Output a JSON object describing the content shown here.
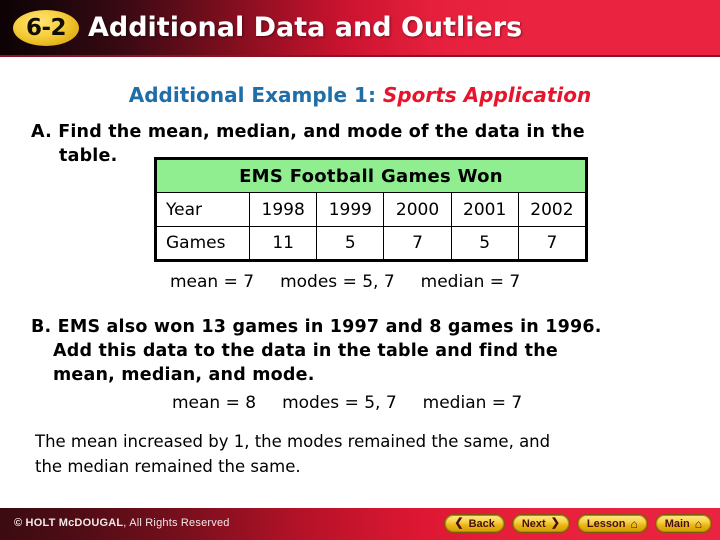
{
  "header": {
    "badge": "6-2",
    "title": "Additional Data and Outliers",
    "accent_red": "#ea2340",
    "badge_gold": "#f6cf3d"
  },
  "example_heading": {
    "lead": "Additional Example 1:",
    "emphasis": "Sports Application",
    "lead_color": "#1f6ea8",
    "emphasis_color": "#e8142b"
  },
  "part_a": {
    "line1": "A. Find the mean, median, and mode of the data in the",
    "line2": "table."
  },
  "table": {
    "caption": "EMS Football Games Won",
    "caption_bg": "#90ee90",
    "row_labels": [
      "Year",
      "Games"
    ],
    "years": [
      "1998",
      "1999",
      "2000",
      "2001",
      "2002"
    ],
    "games": [
      "11",
      "5",
      "7",
      "5",
      "7"
    ]
  },
  "answer_a": {
    "mean": "mean = 7",
    "modes": "modes = 5, 7",
    "median": "median = 7"
  },
  "part_b": {
    "line1": "B. EMS also won 13 games in 1997 and 8 games in 1996.",
    "line2": "Add this data to the data in the table and find the",
    "line3": "mean, median, and mode."
  },
  "answer_b": {
    "mean": "mean = 8",
    "modes": "modes = 5, 7",
    "median": "median = 7"
  },
  "conclusion": {
    "line1": "The mean increased by 1, the modes remained the same, and",
    "line2": "the median remained the same."
  },
  "footer": {
    "copyright_strong": "© HOLT McDOUGAL",
    "copyright_rest": ", All Rights Reserved",
    "buttons": [
      {
        "label": "Back",
        "icon": "chevron-left",
        "glyph": "❮",
        "icon_side": "left"
      },
      {
        "label": "Next",
        "icon": "chevron-right",
        "glyph": "❯",
        "icon_side": "right"
      },
      {
        "label": "Lesson",
        "icon": "home",
        "glyph": "⌂",
        "icon_side": "right"
      },
      {
        "label": "Main",
        "icon": "home",
        "glyph": "⌂",
        "icon_side": "right"
      }
    ]
  }
}
